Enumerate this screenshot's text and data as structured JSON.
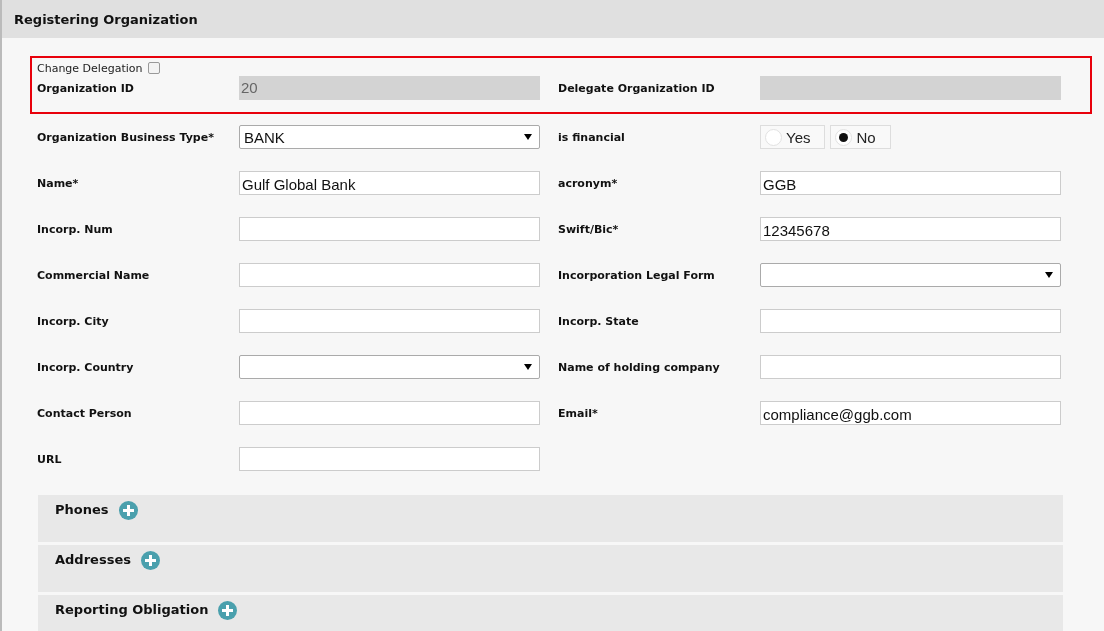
{
  "title": "Registering Organization",
  "delegation": {
    "change_delegation": {
      "label": "Change Delegation",
      "checked": false
    },
    "fields": [
      {
        "kind": "readonly",
        "label": "Organization ID",
        "value": "20"
      },
      {
        "kind": "readonly",
        "label": "Delegate Organization ID"
      }
    ]
  },
  "fields": [
    {
      "kind": "select",
      "label": "Organization Business Type*",
      "value": "BANK"
    },
    {
      "kind": "radio",
      "label": "is financial",
      "options": [
        {
          "label": "Yes",
          "selected": false
        },
        {
          "label": "No",
          "selected": true
        }
      ]
    },
    {
      "kind": "text",
      "label": "Name*",
      "value": "Gulf Global Bank"
    },
    {
      "kind": "text",
      "label": "acronym*",
      "value": "GGB"
    },
    {
      "kind": "text",
      "label": "Incorp. Num"
    },
    {
      "kind": "text",
      "label": "Swift/Bic*",
      "value": "12345678"
    },
    {
      "kind": "text",
      "label": "Commercial Name"
    },
    {
      "kind": "select",
      "label": "Incorporation Legal Form"
    },
    {
      "kind": "text",
      "label": "Incorp. City"
    },
    {
      "kind": "text",
      "label": "Incorp. State"
    },
    {
      "kind": "select",
      "label": "Incorp. Country"
    },
    {
      "kind": "text",
      "label": "Name of holding company"
    },
    {
      "kind": "text",
      "label": "Contact Person"
    },
    {
      "kind": "text",
      "label": "Email*",
      "value": "compliance@ggb.com"
    },
    {
      "kind": "text",
      "label": "URL"
    }
  ],
  "sections": [
    {
      "title": "Phones"
    },
    {
      "title": "Addresses"
    },
    {
      "title": "Reporting Obligation"
    }
  ]
}
